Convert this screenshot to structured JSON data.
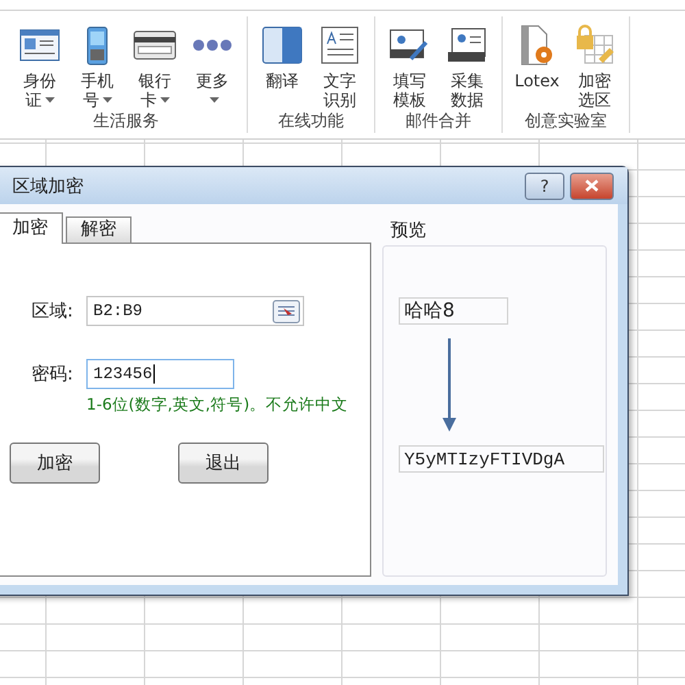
{
  "ribbon": {
    "groups": [
      {
        "title": "生活服务",
        "items": [
          {
            "label": "身份证",
            "kind": "id-card",
            "dropdown": true
          },
          {
            "label": "手机号",
            "kind": "phone",
            "dropdown": true
          },
          {
            "label": "银行卡",
            "kind": "card",
            "dropdown": true
          },
          {
            "label": "更多",
            "kind": "dots",
            "dropdown": true
          }
        ]
      },
      {
        "title": "在线功能",
        "items": [
          {
            "label": "翻译",
            "kind": "translate",
            "dropdown": false
          },
          {
            "label": "文字识别",
            "kind": "ocr",
            "dropdown": false
          }
        ]
      },
      {
        "title": "邮件合并",
        "items": [
          {
            "label": "填写模板",
            "kind": "fill",
            "dropdown": false
          },
          {
            "label": "采集数据",
            "kind": "collect",
            "dropdown": false
          }
        ]
      },
      {
        "title": "创意实验室",
        "items": [
          {
            "label": "Lotex",
            "kind": "lotex",
            "dropdown": false
          },
          {
            "label": "加密选区",
            "kind": "lock",
            "dropdown": false
          }
        ]
      }
    ]
  },
  "dialog": {
    "title": "区域加密",
    "help_button": "?",
    "tabs": [
      {
        "label": "加密",
        "selected": true
      },
      {
        "label": "解密",
        "selected": false
      }
    ],
    "range": {
      "label": "区域:",
      "value": "B2:B9"
    },
    "password": {
      "label": "密码:",
      "value": "123456",
      "hint": "1-6位(数字,英文,符号)。不允许中文"
    },
    "buttons": [
      "加密",
      "退出"
    ],
    "preview": {
      "title": "预览",
      "input": "哈哈8",
      "output": "Y5yMTIzyFTIVDgA"
    }
  }
}
